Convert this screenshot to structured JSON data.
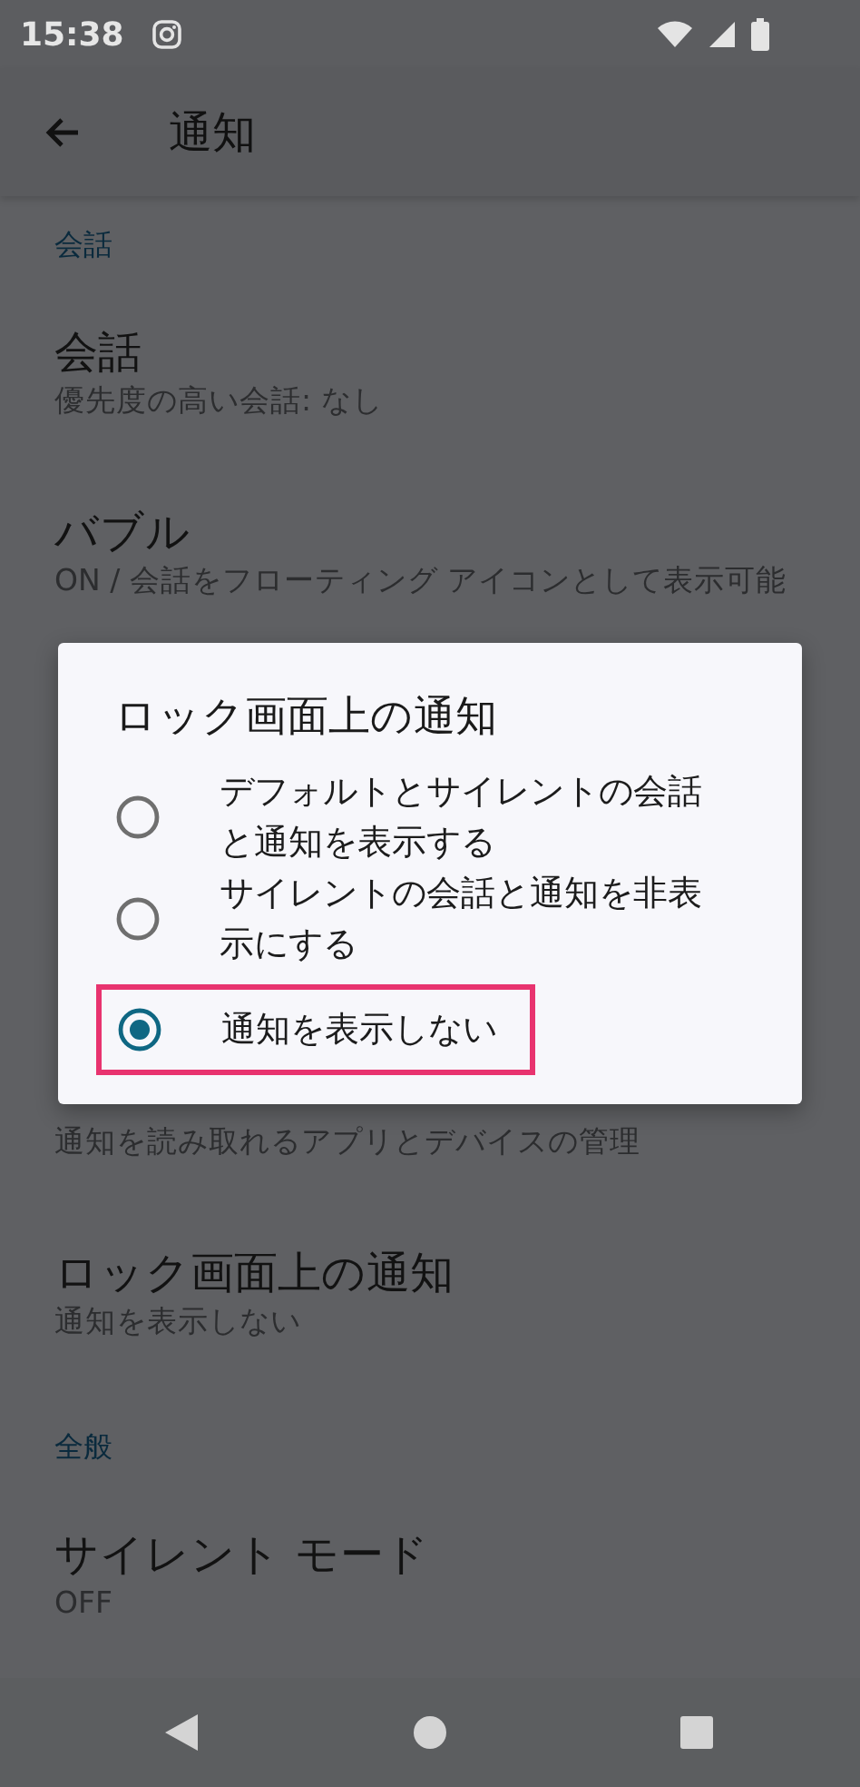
{
  "status_bar": {
    "time": "15:38"
  },
  "app_bar": {
    "title": "通知"
  },
  "list": [
    {
      "kind": "header",
      "title": "会話"
    },
    {
      "kind": "item",
      "title": "会話",
      "summary": "優先度の高い会話: なし"
    },
    {
      "kind": "item",
      "title": "バブル",
      "summary": "ON / 会話をフローティング アイコンとして表示可能"
    },
    {
      "kind": "covered",
      "summary": "通知を読み取れるアプリとデバイスの管理"
    },
    {
      "kind": "item",
      "title": "ロック画面上の通知",
      "summary": "通知を表示しない"
    },
    {
      "kind": "header",
      "title": "全般"
    },
    {
      "kind": "item",
      "title": "サイレント モード",
      "summary": "OFF"
    }
  ],
  "dialog": {
    "title": "ロック画面上の通知",
    "options": [
      {
        "label": "デフォルトとサイレントの会話と通知を表示する",
        "selected": false,
        "highlighted": false
      },
      {
        "label": "サイレントの会話と通知を非表示にする",
        "selected": false,
        "highlighted": false
      },
      {
        "label": "通知を表示しない",
        "selected": true,
        "highlighted": true
      }
    ]
  }
}
